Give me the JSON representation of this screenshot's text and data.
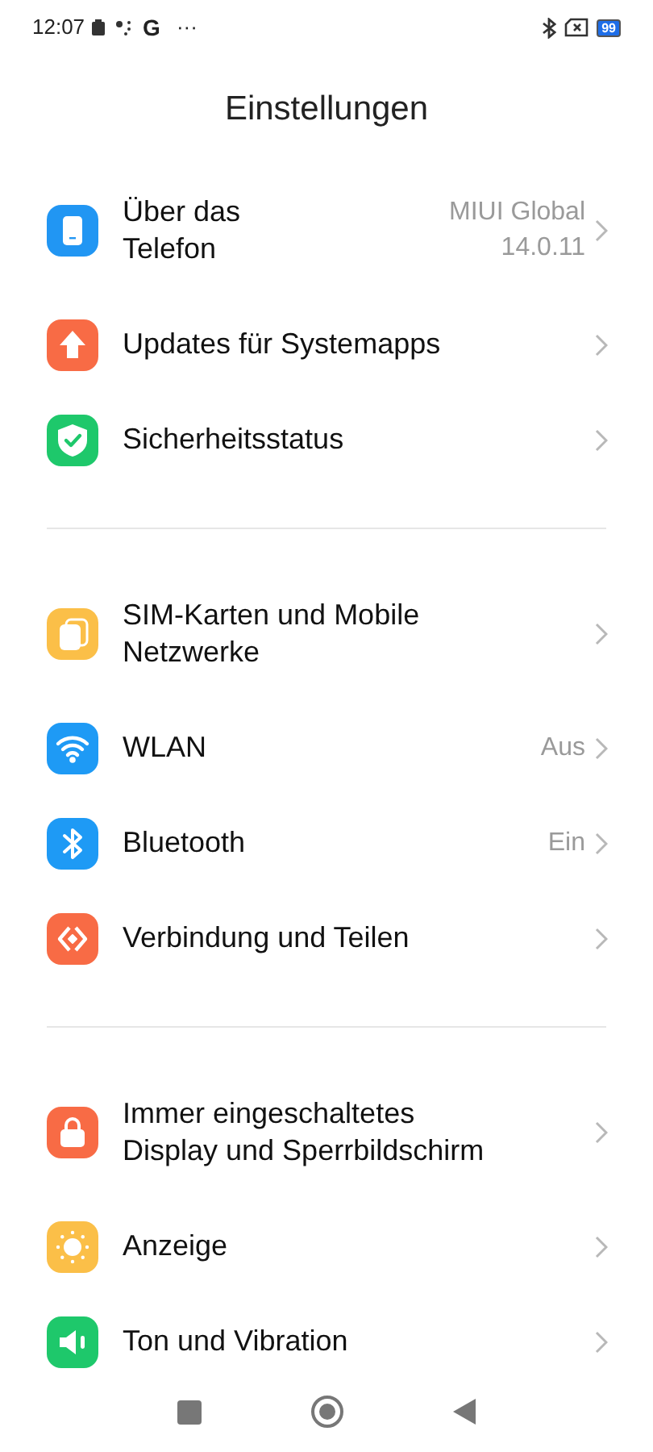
{
  "status_bar": {
    "time": "12:07",
    "google": "G",
    "more": "···",
    "battery": "99"
  },
  "title": "Einstellungen",
  "groups": [
    {
      "items": [
        {
          "label": "Über das Telefon",
          "value": "MIUI Global 14.0.11",
          "color": "#2196f3"
        },
        {
          "label": "Updates für Systemapps",
          "color": "#f86b45"
        },
        {
          "label": "Sicherheitsstatus",
          "color": "#1ec86b"
        }
      ]
    },
    {
      "items": [
        {
          "label": "SIM-Karten und Mobile Netzwerke",
          "color": "#fbbf48"
        },
        {
          "label": "WLAN",
          "value": "Aus",
          "color": "#1e9af5"
        },
        {
          "label": "Bluetooth",
          "value": "Ein",
          "color": "#1e9af5"
        },
        {
          "label": "Verbindung und Teilen",
          "color": "#f86b45"
        }
      ]
    },
    {
      "items": [
        {
          "label": "Immer eingeschaltetes Display und Sperrbildschirm",
          "color": "#f86b45"
        },
        {
          "label": "Anzeige",
          "color": "#fbbf48"
        },
        {
          "label": "Ton und Vibration",
          "color": "#1ec86b"
        }
      ]
    }
  ]
}
